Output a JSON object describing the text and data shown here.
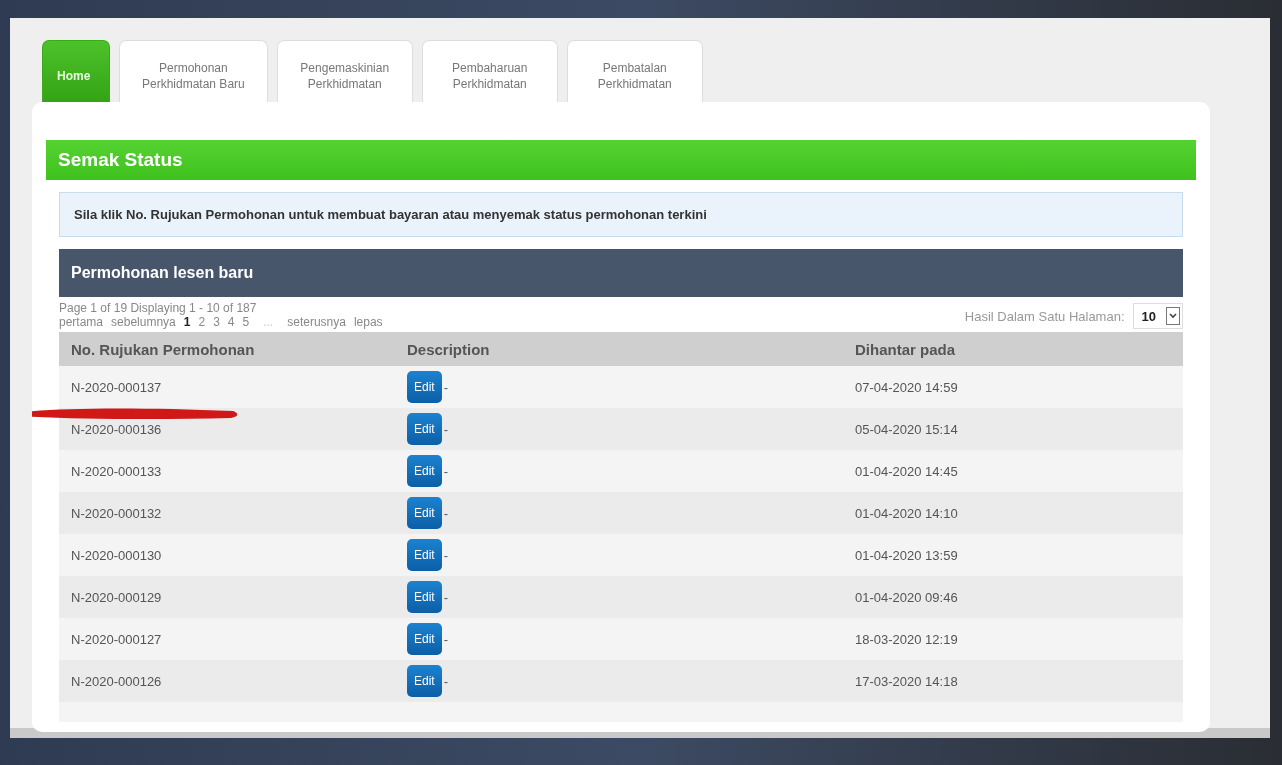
{
  "tabs": [
    {
      "label": "Home",
      "selected": true
    },
    {
      "label": "Permohonan\nPerkhidmatan Baru",
      "selected": false
    },
    {
      "label": "Pengemaskinian\nPerkhidmatan",
      "selected": false
    },
    {
      "label": "Pembaharuan\nPerkhidmatan",
      "selected": false
    },
    {
      "label": "Pembatalan\nPerkhidmatan",
      "selected": false
    }
  ],
  "section_title": "Semak Status",
  "info": "Sila klik No. Rujukan Permohonan untuk membuat bayaran atau menyemak status permohonan terkini",
  "table_title": "Permohonan lesen baru",
  "pagination": {
    "summary": "Page 1 of 19 Displaying 1 - 10 of 187",
    "first": "pertama",
    "previous": "sebelumnya",
    "pages": [
      {
        "label": "1",
        "selected": true
      },
      {
        "label": "2",
        "selected": false
      },
      {
        "label": "3",
        "selected": false
      },
      {
        "label": "4",
        "selected": false
      },
      {
        "label": "5",
        "selected": false
      }
    ],
    "ellipsis": "...",
    "next": "seterusnya",
    "last": "lepas"
  },
  "page_size": {
    "label": "Hasil Dalam Satu Halaman:",
    "value": "10"
  },
  "columns": [
    "No. Rujukan Permohonan",
    "Description",
    "Dihantar pada"
  ],
  "rows": [
    {
      "ref": "N-2020-000137",
      "action": "Edit",
      "description": "-",
      "date": "07-04-2020 14:59",
      "scribbled": false
    },
    {
      "ref": "N-2020-000136",
      "action": "Edit",
      "description": "-",
      "date": "05-04-2020 15:14",
      "scribbled": true
    },
    {
      "ref": "N-2020-000133",
      "action": "Edit",
      "description": "-",
      "date": "01-04-2020 14:45",
      "scribbled": false
    },
    {
      "ref": "N-2020-000132",
      "action": "Edit",
      "description": "-",
      "date": "01-04-2020 14:10",
      "scribbled": false
    },
    {
      "ref": "N-2020-000130",
      "action": "Edit",
      "description": "-",
      "date": "01-04-2020 13:59",
      "scribbled": false
    },
    {
      "ref": "N-2020-000129",
      "action": "Edit",
      "description": "-",
      "date": "01-04-2020 09:46",
      "scribbled": false
    },
    {
      "ref": "N-2020-000127",
      "action": "Edit",
      "description": "-",
      "date": "18-03-2020 12:19",
      "scribbled": false
    },
    {
      "ref": "N-2020-000126",
      "action": "Edit",
      "description": "-",
      "date": "17-03-2020 14:18",
      "scribbled": false
    }
  ]
}
